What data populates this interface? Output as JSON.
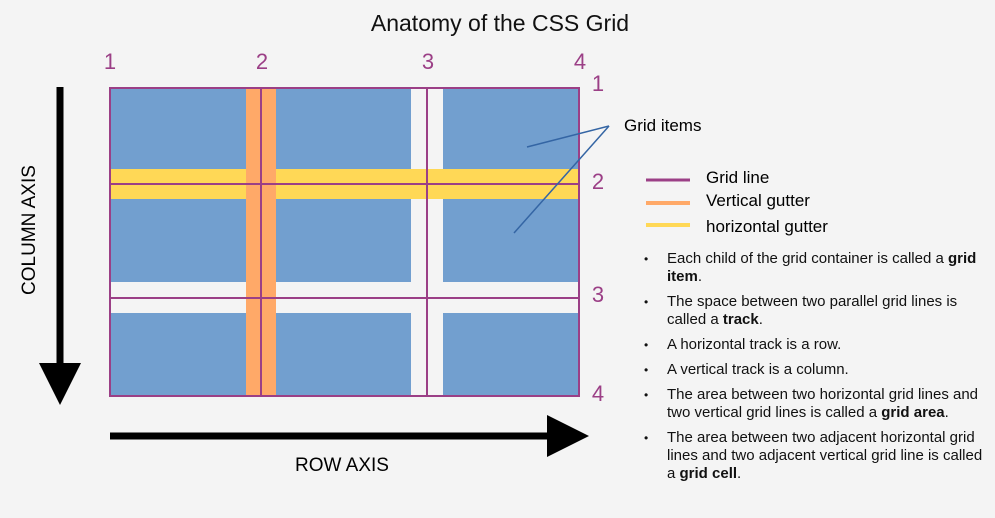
{
  "title": "Anatomy of the CSS Grid",
  "column_line_numbers": [
    "1",
    "2",
    "3",
    "4"
  ],
  "row_line_numbers": [
    "1",
    "2",
    "3",
    "4"
  ],
  "column_axis_label": "COLUMN AXIS",
  "row_axis_label": "ROW AXIS",
  "grid_items_callout": "Grid items",
  "legend": [
    {
      "label": "Grid line",
      "color": "#9b3f86"
    },
    {
      "label": "Vertical gutter",
      "color": "#ffa968"
    },
    {
      "label": "horizontal gutter",
      "color": "#ffd856"
    }
  ],
  "notes": [
    {
      "pre": "Each child of the grid container is called a ",
      "bold": "grid item",
      "post": "."
    },
    {
      "pre": "The space between two parallel grid lines is called a ",
      "bold": "track",
      "post": "."
    },
    {
      "pre": "A horizontal track is a row.",
      "bold": "",
      "post": ""
    },
    {
      "pre": "A vertical track is a column.",
      "bold": "",
      "post": ""
    },
    {
      "pre": "The area between two horizontal grid lines and two vertical grid lines is called a ",
      "bold": "grid area",
      "post": "."
    },
    {
      "pre": "The area between two adjacent horizontal grid lines and two adjacent vertical grid line is called a ",
      "bold": "grid cell",
      "post": "."
    }
  ],
  "colors": {
    "grid_item": "#729fcf",
    "grid_line": "#9b3f86",
    "vertical_gutter": "#ffa968",
    "horizontal_gutter": "#ffd856",
    "line_number": "#9b3f86",
    "callout_line": "#3465a4"
  }
}
